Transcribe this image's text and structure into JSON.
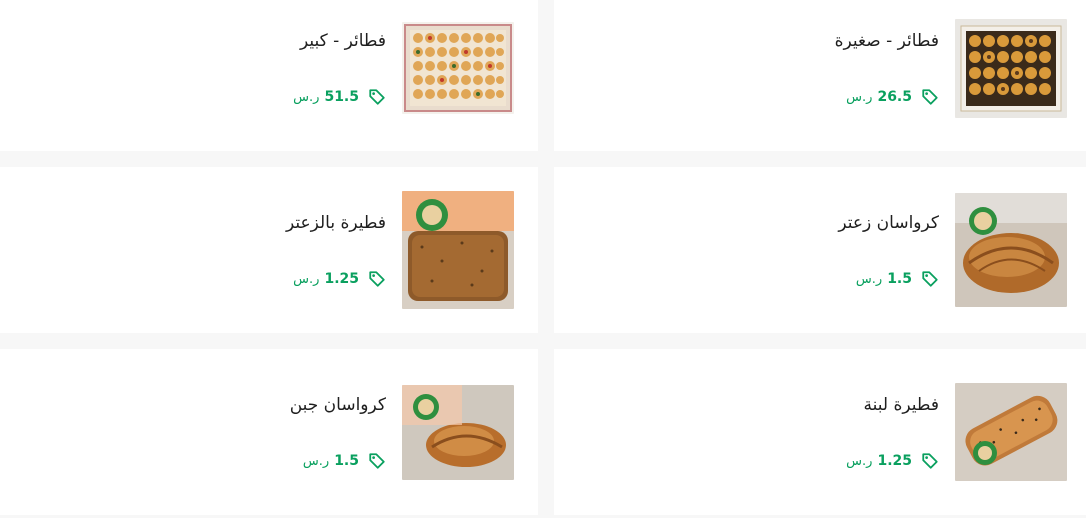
{
  "currency_label": "ر.س",
  "products": [
    {
      "name": "فطائر - صغيرة",
      "price": "26.5",
      "image_icon": "pastry-box-small-icon"
    },
    {
      "name": "فطائر - كبير",
      "price": "51.5",
      "image_icon": "pastry-box-large-icon"
    },
    {
      "name": "كرواسان زعتر",
      "price": "1.5",
      "image_icon": "croissant-thyme-icon"
    },
    {
      "name": "فطيرة بالزعتر",
      "price": "1.25",
      "image_icon": "thyme-pie-icon"
    },
    {
      "name": "فطيرة لبنة",
      "price": "1.25",
      "image_icon": "labneh-pie-icon"
    },
    {
      "name": "كرواسان جبن",
      "price": "1.5",
      "image_icon": "cheese-croissant-icon"
    }
  ],
  "colors": {
    "accent": "#0aa05f",
    "card": "#ffffff",
    "background": "#f7f7f7"
  }
}
